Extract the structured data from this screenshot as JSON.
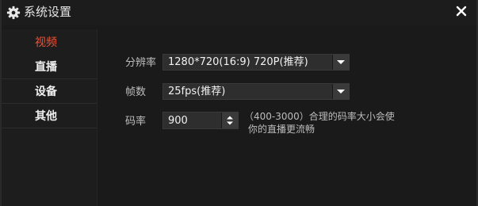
{
  "window": {
    "title": "系统设置",
    "icons": {
      "title": "gear-icon",
      "close": "close-icon"
    }
  },
  "sidebar": {
    "items": [
      {
        "label": "视频",
        "active": true
      },
      {
        "label": "直播",
        "active": false
      },
      {
        "label": "设备",
        "active": false
      },
      {
        "label": "其他",
        "active": false
      }
    ]
  },
  "video": {
    "resolution": {
      "label": "分辨率",
      "value": "1280*720(16:9) 720P(推荐)"
    },
    "framerate": {
      "label": "帧数",
      "value": "25fps(推荐)"
    },
    "bitrate": {
      "label": "码率",
      "value": "900",
      "hint_line1": "（400-3000）合理的码率大小会使",
      "hint_line2": "你的直播更流畅"
    }
  },
  "colors": {
    "accent": "#e9553a",
    "background": "#1a1a1a",
    "control": "#2e2e2e"
  }
}
